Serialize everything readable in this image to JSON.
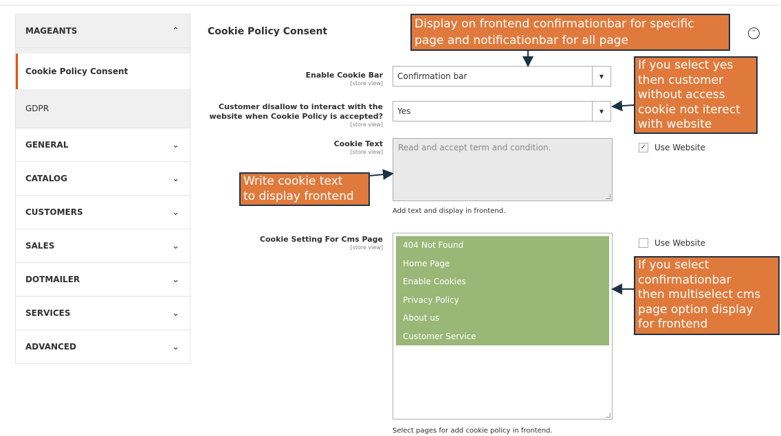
{
  "sidebar": {
    "active_section": "MAGEANTS",
    "active_subitems": [
      "Cookie Policy Consent",
      "GDPR"
    ],
    "sections": [
      {
        "label": "GENERAL"
      },
      {
        "label": "CATALOG"
      },
      {
        "label": "CUSTOMERS"
      },
      {
        "label": "SALES"
      },
      {
        "label": "DOTMAILER"
      },
      {
        "label": "SERVICES"
      },
      {
        "label": "ADVANCED"
      }
    ]
  },
  "main": {
    "title": "Cookie Policy Consent",
    "fields": {
      "enable_bar": {
        "label": "Enable Cookie Bar",
        "scope": "[store view]",
        "value": "Confirmation bar"
      },
      "disallow": {
        "label_line1": "Customer disallow to interact with the",
        "label_line2": "website when Cookie Policy is accepted?",
        "scope": "[store view]",
        "value": "Yes"
      },
      "cookie_text": {
        "label": "Cookie Text",
        "scope": "[store view]",
        "placeholder": "Read and accept term and condition.",
        "note": "Add text and display in frontend.",
        "use_website": "Use Website"
      },
      "cms_pages": {
        "label": "Cookie Setting For Cms Page",
        "scope": "[store view]",
        "options": [
          "404 Not Found",
          "Home Page",
          "Enable Cookies",
          "Privacy Policy",
          "About us",
          "Customer Service"
        ],
        "note": "Select pages for add cookie policy in frontend.",
        "use_website": "Use Website"
      }
    }
  },
  "annotations": {
    "top": [
      "Display on frontend confirmationbar for specific",
      "page and notificationbar for all page"
    ],
    "right_yes": [
      "If you select yes",
      "then customer",
      "without access",
      "cookie not iterect",
      "with website"
    ],
    "left_text": [
      "Write cookie text",
      "to display frontend"
    ],
    "right_cms": [
      "If you select",
      "confirmationbar",
      "then multiselect cms",
      "page option display",
      "for frontend"
    ]
  },
  "colors": {
    "accent": "#eb5202",
    "option_bg": "#99b777",
    "callout_bg": "#df7a3c",
    "callout_border": "#1d3245"
  },
  "icons": {
    "collapse": "chevron-up-circle-icon",
    "expand": "chevron-down-icon",
    "select_arrow": "triangle-down-icon",
    "check": "checkmark-icon"
  }
}
